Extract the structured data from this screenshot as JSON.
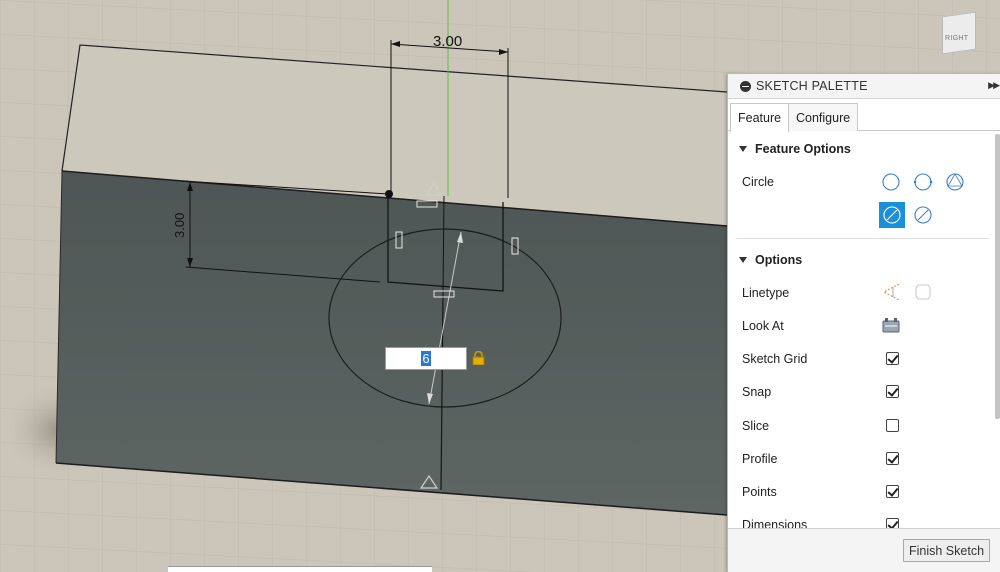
{
  "viewport": {
    "dimension_top": "3.00",
    "dimension_left": "3.00",
    "dimension_input_value": "6",
    "viewcube_label": "RIGHT"
  },
  "palette": {
    "title": "SKETCH PALETTE",
    "tabs": [
      {
        "label": "Feature",
        "active": true
      },
      {
        "label": "Configure",
        "active": false
      }
    ],
    "feature_options": {
      "heading": "Feature Options",
      "circle_label": "Circle",
      "circle_icons": [
        "center-diameter-circle-icon",
        "two-point-circle-icon",
        "three-point-circle-icon",
        "construction-circle-icon",
        "diameter-dimension-icon"
      ],
      "selected_icon": "construction-circle-icon"
    },
    "options": {
      "heading": "Options",
      "rows": [
        {
          "label": "Linetype",
          "control": "linetype-icon"
        },
        {
          "label": "Look At",
          "control": "look-at-icon"
        },
        {
          "label": "Sketch Grid",
          "checked": true
        },
        {
          "label": "Snap",
          "checked": true
        },
        {
          "label": "Slice",
          "checked": false
        },
        {
          "label": "Profile",
          "checked": true
        },
        {
          "label": "Points",
          "checked": true
        },
        {
          "label": "Dimensions",
          "checked": true
        }
      ]
    },
    "finish_label": "Finish Sketch"
  },
  "colors": {
    "background": "#cbc6b9",
    "body_face": "#58605e",
    "selection": "#1a90d9",
    "lock": "#d7a800"
  }
}
